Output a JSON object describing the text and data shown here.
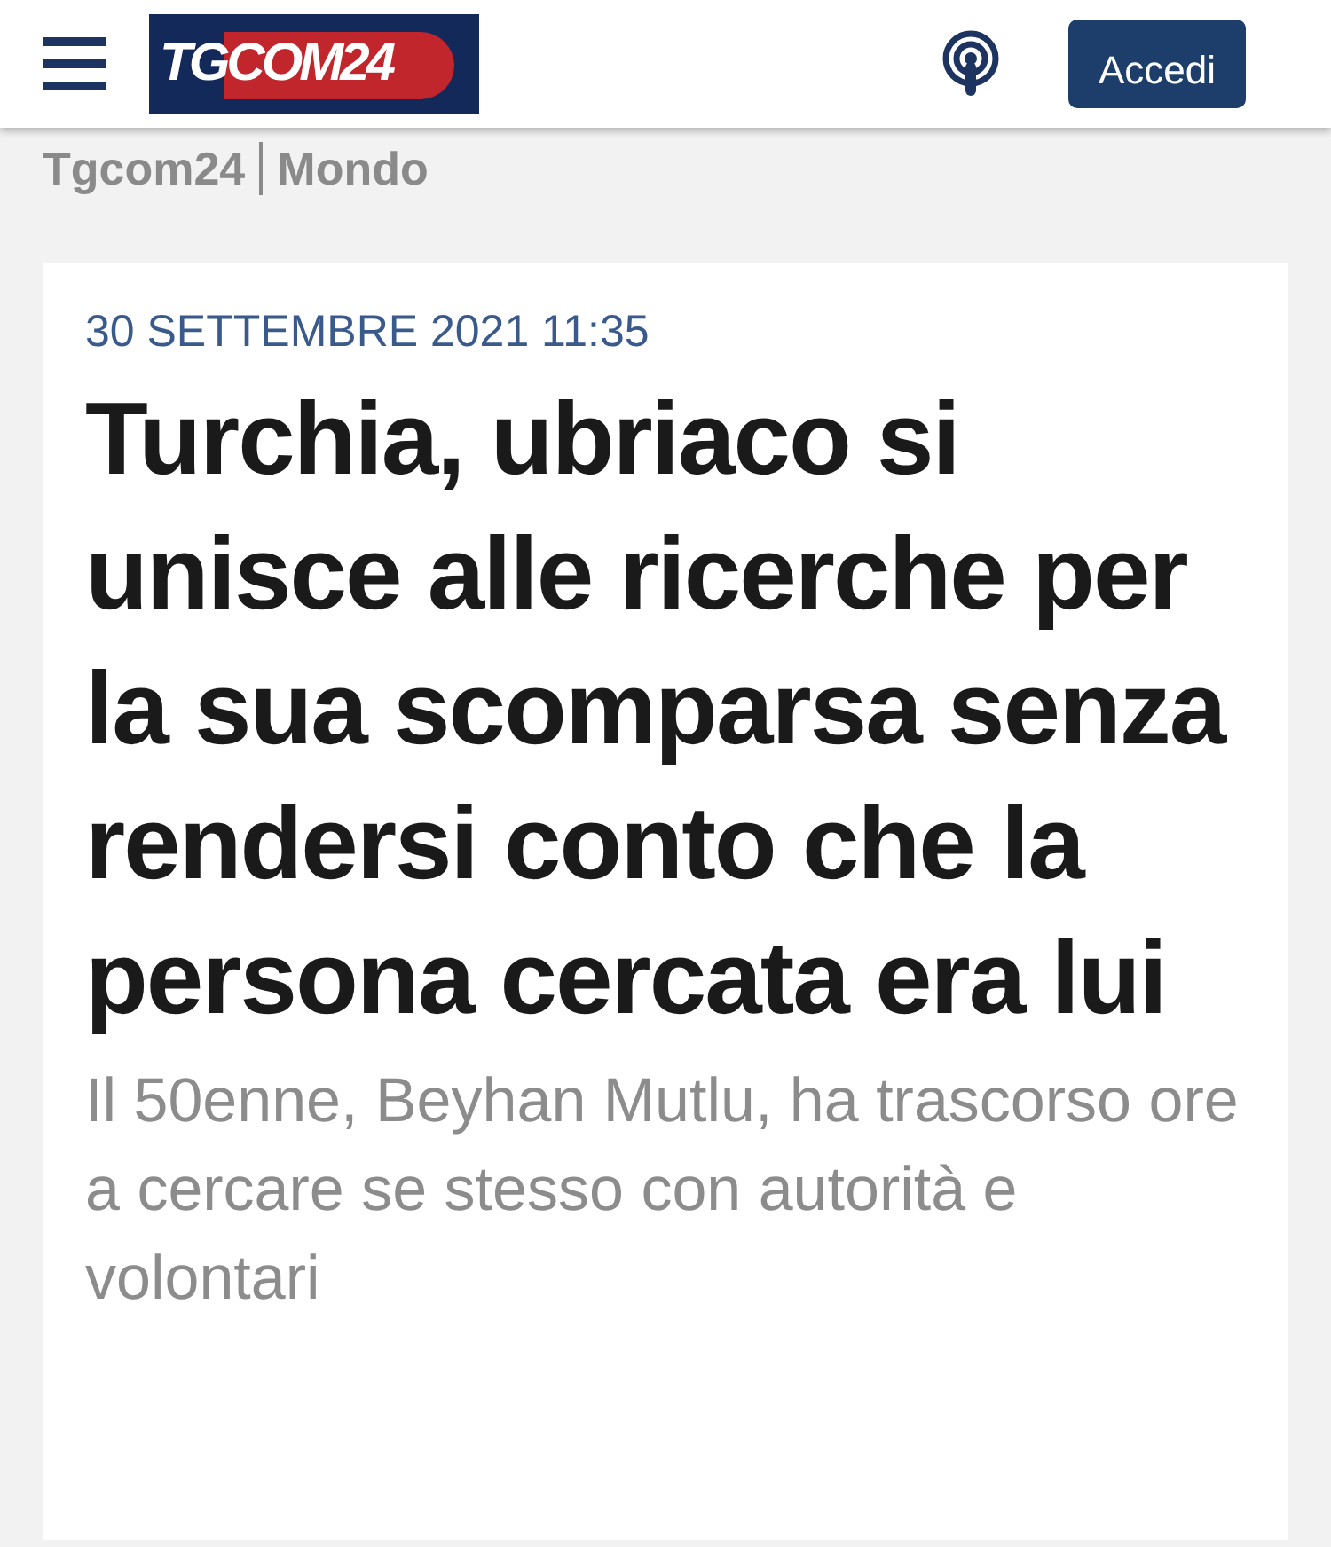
{
  "header": {
    "logo": "TGCOM24",
    "login_button": "Accedi"
  },
  "breadcrumb": [
    "Tgcom24",
    "Mondo"
  ],
  "article": {
    "date": "30 SETTEMBRE 2021 11:35",
    "headline": "Turchia, ubriaco si unisce alle ricerche per la sua scomparsa senza rendersi conto che la persona cercata era lui",
    "subtitle": "Il 50enne, Beyhan Mutlu, ha trascorso ore a cercare se stesso con autorità e volontari"
  }
}
